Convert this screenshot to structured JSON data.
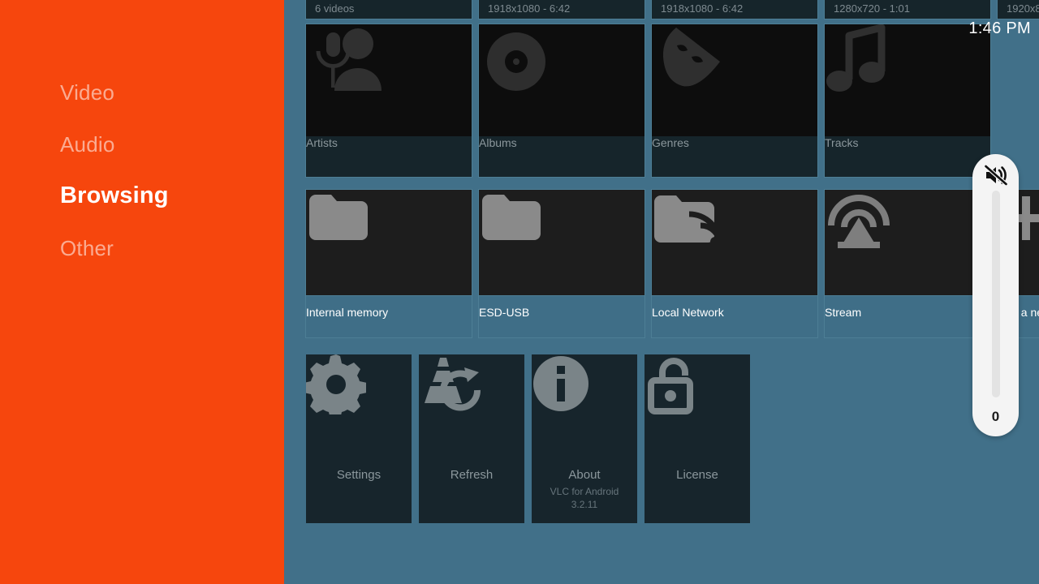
{
  "app": {
    "name": "VLC for Android",
    "version": "3.2.11",
    "accent_color": "#f6460d",
    "background_color": "#417089",
    "tile_color": "#16252b"
  },
  "clock": {
    "time": "1:46 PM"
  },
  "sidebar": {
    "items": [
      {
        "label": "Video",
        "active": false
      },
      {
        "label": "Audio",
        "active": false
      },
      {
        "label": "Browsing",
        "active": true
      },
      {
        "label": "Other",
        "active": false
      }
    ]
  },
  "video_row": {
    "items": [
      {
        "meta": "6 videos"
      },
      {
        "meta": "1918x1080 - 6:42"
      },
      {
        "meta": "1918x1080 - 6:42"
      },
      {
        "meta": "1280x720 - 1:01"
      },
      {
        "meta": "1920x8"
      }
    ]
  },
  "audio_row": {
    "items": [
      {
        "label": "Artists",
        "icon": "microphone-person-icon"
      },
      {
        "label": "Albums",
        "icon": "vinyl-disc-icon"
      },
      {
        "label": "Genres",
        "icon": "theater-mask-icon"
      },
      {
        "label": "Tracks",
        "icon": "music-note-icon"
      }
    ]
  },
  "browsing_row": {
    "items": [
      {
        "label": "Internal memory",
        "icon": "folder-icon"
      },
      {
        "label": "ESD-USB",
        "icon": "folder-icon"
      },
      {
        "label": "Local Network",
        "icon": "folder-network-icon"
      },
      {
        "label": "Stream",
        "icon": "broadcast-antenna-icon"
      },
      {
        "label": "Add a network share",
        "icon": "plus-icon"
      }
    ]
  },
  "misc_row": {
    "items": [
      {
        "label": "Settings",
        "sub": "",
        "icon": "gear-icon"
      },
      {
        "label": "Refresh",
        "sub": "",
        "icon": "vlc-cone-refresh-icon"
      },
      {
        "label": "About",
        "sub": "VLC for Android\n3.2.11",
        "icon": "info-icon"
      },
      {
        "label": "License",
        "sub": "",
        "icon": "open-padlock-icon"
      }
    ]
  },
  "volume": {
    "value": "0",
    "level_percent": 0,
    "icon": "volume-muted-icon",
    "state": "muted"
  }
}
